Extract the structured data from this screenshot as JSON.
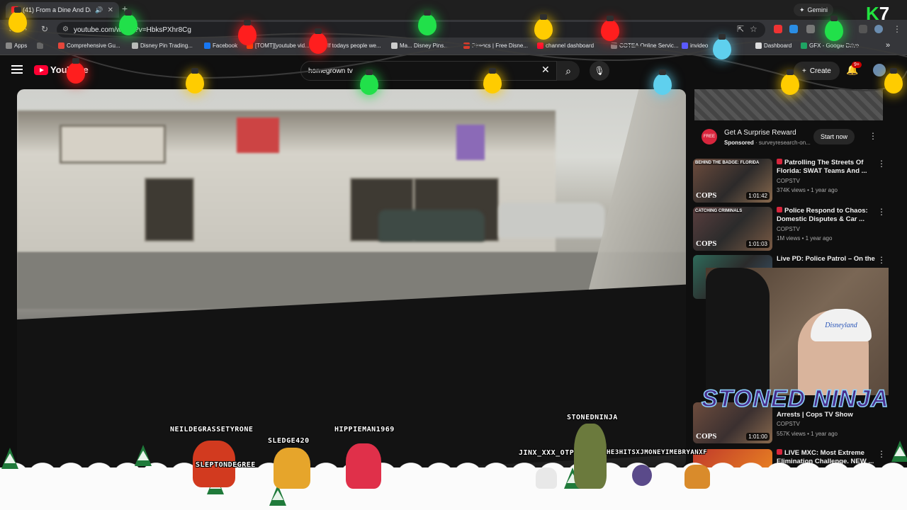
{
  "browser": {
    "tab_title": "(41) From a Dine And Dash",
    "tab_close": "✕",
    "new_tab": "+",
    "gemini_label": "Gemini",
    "url": "youtube.com/watch?v=HbksPXhr8Cg",
    "bookmarks": [
      {
        "label": "Apps",
        "color": "#888888"
      },
      {
        "label": "Comprehensive Gu...",
        "color": "#e4463b"
      },
      {
        "label": "Disney Pin Trading...",
        "color": "#bbbbbb"
      },
      {
        "label": "Facebook",
        "color": "#1877f2"
      },
      {
        "label": "[TOMT][youtube vid...",
        "color": "#ff4500"
      },
      {
        "label": "If todays people we...",
        "color": "#999999"
      },
      {
        "label": "Ma... Disney Pins...",
        "color": "#cccccc"
      },
      {
        "label": "PinPics | Free Disne...",
        "color": "#d73b2b"
      },
      {
        "label": "channel dashboard",
        "color": "#ff0033"
      },
      {
        "label": "COTEA Online Servic...",
        "color": "#888888"
      },
      {
        "label": "invideo",
        "color": "#5a5aff"
      },
      {
        "label": "Dashboard",
        "color": "#dddddd"
      },
      {
        "label": "GFX - Google Drive",
        "color": "#1fa463"
      }
    ],
    "bookmarks_more": "»"
  },
  "youtube": {
    "logo_text": "YouTube",
    "search_value": "homegrown tv",
    "search_clear": "✕",
    "create_label": "Create",
    "notif_count": "9+"
  },
  "ad": {
    "icon_text": "FREE",
    "title": "Get A Surprise Reward",
    "sponsored": "Sponsored",
    "domain": "surveyresearch-on...",
    "cta": "Start now"
  },
  "recommendations": [
    {
      "title": "Patrolling The Streets Of Florida: SWAT Teams And ...",
      "channel": "COPSTV",
      "meta": "374K views • 1 year ago",
      "duration": "1:01:42",
      "brand": "BEHIND THE BADGE: FLORIDA"
    },
    {
      "title": "Police Respond to Chaos: Domestic Disputes & Car ...",
      "channel": "COPSTV",
      "meta": "1M views • 1 year ago",
      "duration": "1:01:03",
      "brand": "CATCHING CRIMINALS"
    },
    {
      "title": "Live PD: Police Patrol – On the",
      "channel": "",
      "meta": "",
      "duration": "",
      "brand": ""
    },
    {
      "title": "Arrests | Cops TV Show",
      "channel": "COPSTV",
      "meta": "557K views • 1 year ago",
      "duration": "1:01:00",
      "brand": ""
    },
    {
      "title": "LIVE MXC: Most Extreme Elimination Challenge. NEW ...",
      "channel": "",
      "meta": "",
      "duration": "",
      "brand": ""
    }
  ],
  "overlay": {
    "streamer_name": "STONED NINJA",
    "hat_text": "Disneyland",
    "cops_label": "COPS",
    "k7_k": "K",
    "k7_num": "7",
    "chat_names": [
      "NEILDEGRASSETYRONE",
      "SLEDGE420",
      "HIPPIEMAN1969",
      "STONEDNINJA",
      "SLEPTONDEGREE",
      "JINX_XXX_OTP",
      "HE3HITSXJMONEYIMEBRYANXF"
    ]
  }
}
